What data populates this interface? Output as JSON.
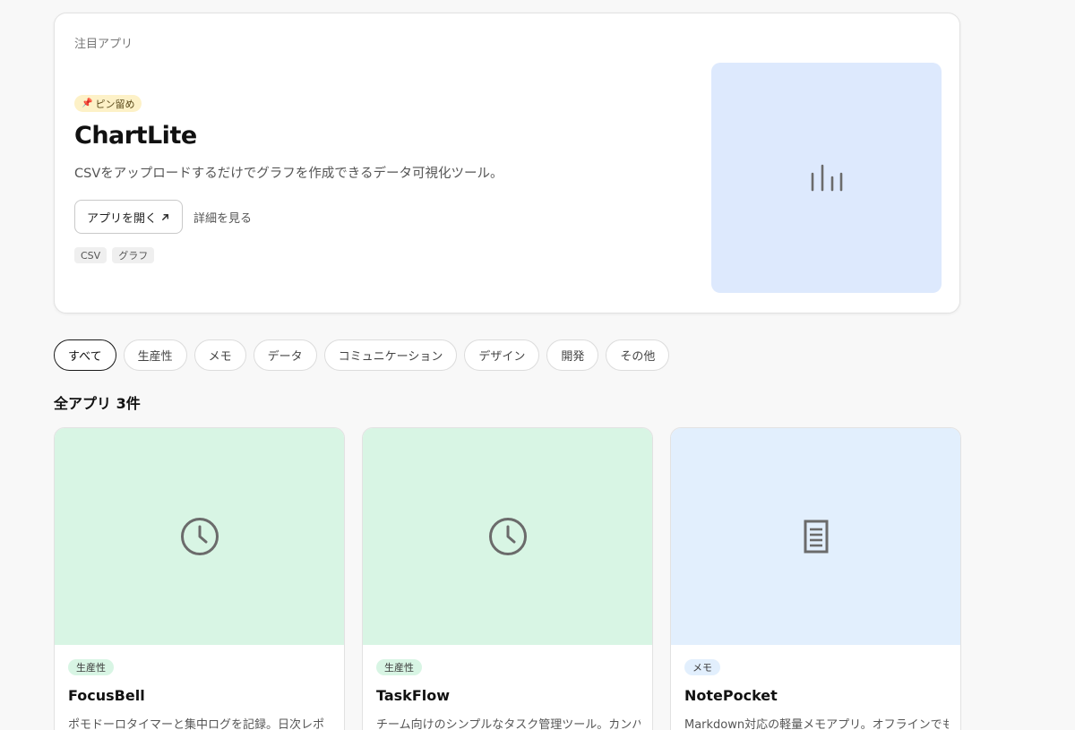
{
  "featured": {
    "label": "注目アプリ",
    "badge_icon": "pushpin-icon",
    "badge": "ピン留め",
    "title": "ChartLite",
    "description": "CSVをアップロードするだけでグラフを作成できるデータ可視化ツール。",
    "open_button": "アプリを開く",
    "open_icon": "external-arrow-icon",
    "detail_link": "詳細を見る",
    "tags": [
      "CSV",
      "グラフ"
    ],
    "thumb_color": "#dde9fd",
    "thumb_icon": "bar-chart-icon"
  },
  "categories": [
    {
      "label": "すべて",
      "active": true
    },
    {
      "label": "生産性",
      "active": false
    },
    {
      "label": "メモ",
      "active": false
    },
    {
      "label": "データ",
      "active": false
    },
    {
      "label": "コミュニケーション",
      "active": false
    },
    {
      "label": "デザイン",
      "active": false
    },
    {
      "label": "開発",
      "active": false
    },
    {
      "label": "その他",
      "active": false
    }
  ],
  "section_title": "全アプリ 3件",
  "apps": [
    {
      "name": "FocusBell",
      "category": "生産性",
      "description": "ポモドーロタイマーと集中ログを記録。日次レポ",
      "thumb_color": "#d8f5e4",
      "tag_color": "#d8f5e4",
      "icon": "clock-icon"
    },
    {
      "name": "TaskFlow",
      "category": "生産性",
      "description": "チーム向けのシンプルなタスク管理ツール。カンバ",
      "thumb_color": "#d8f5e4",
      "tag_color": "#d8f5e4",
      "icon": "clock-icon"
    },
    {
      "name": "NotePocket",
      "category": "メモ",
      "description": "Markdown対応の軽量メモアプリ。オフラインでも",
      "thumb_color": "#e2effd",
      "tag_color": "#e2effd",
      "icon": "document-icon"
    }
  ]
}
